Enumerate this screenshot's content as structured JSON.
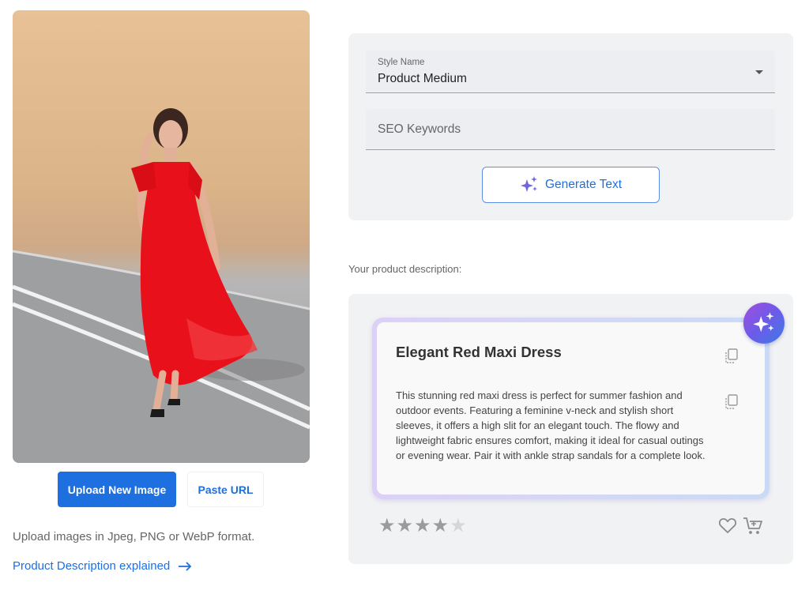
{
  "image_panel": {
    "upload_button": "Upload New Image",
    "paste_url_button": "Paste URL",
    "format_hint": "Upload images in Jpeg, PNG or WebP format.",
    "explained_link": "Product Description explained",
    "arrow_icon": "arrow-right-icon"
  },
  "settings": {
    "style_label": "Style Name",
    "style_value": "Product Medium",
    "seo_placeholder": "SEO Keywords",
    "seo_value": "",
    "generate_button": "Generate Text",
    "generate_icon": "sparkles-icon"
  },
  "result": {
    "section_label": "Your product description:",
    "title": "Elegant Red Maxi Dress",
    "description": "This stunning red maxi dress is perfect for summer fashion and outdoor events. Featuring a feminine v-neck and stylish short sleeves, it offers a high slit for an elegant touch. The flowy and lightweight fabric ensures comfort, making it ideal for casual outings or evening wear. Pair it with ankle strap sandals for a complete look.",
    "rating": 4,
    "rating_max": 5,
    "icons": [
      "copy-icon",
      "sparkles-icon",
      "heart-icon",
      "cart-icon"
    ]
  },
  "colors": {
    "primary": "#1e6fe0",
    "panel_bg": "#f1f2f4",
    "star_filled": "#9b9b9b",
    "star_empty": "#d6d6d6",
    "badge_gradient": [
      "#a24ee0",
      "#3d7be6"
    ]
  }
}
